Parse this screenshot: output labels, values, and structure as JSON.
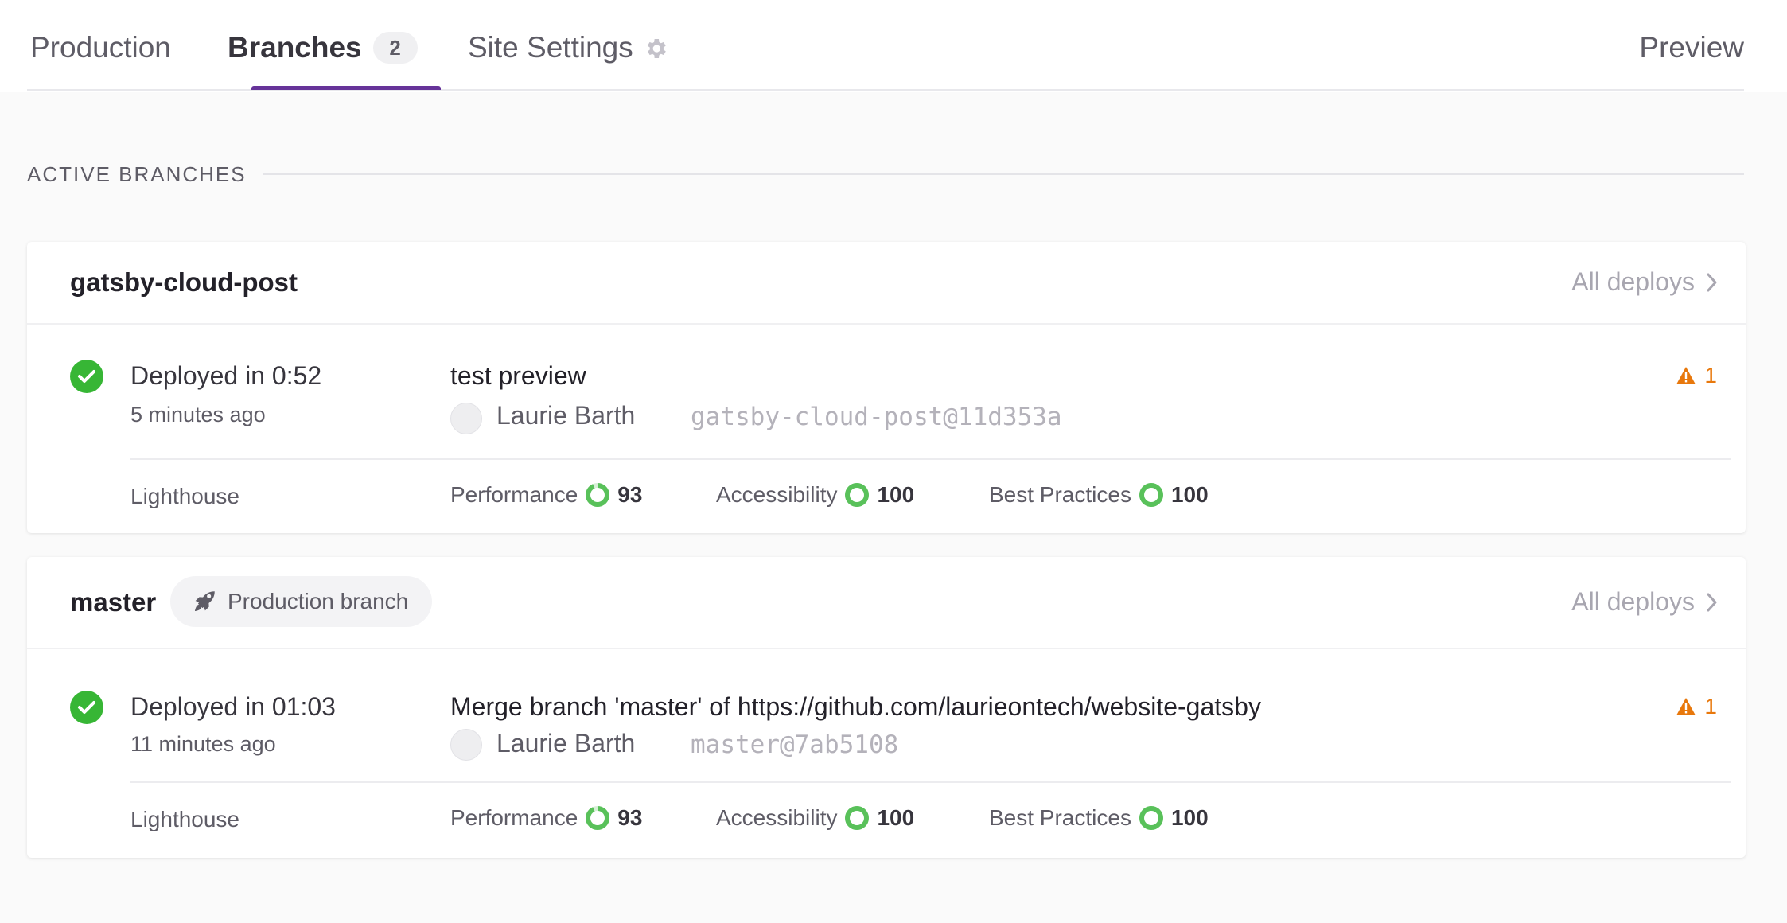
{
  "tabs": [
    {
      "label": "Production"
    },
    {
      "label": "Branches",
      "count": "2"
    },
    {
      "label": "Site Settings"
    }
  ],
  "preview_label": "Preview",
  "section_title": "ACTIVE BRANCHES",
  "colors": {
    "accent": "#663399",
    "success": "#37b635",
    "warning": "#e8780c",
    "ring": "#59c15a"
  },
  "branches": [
    {
      "name": "gatsby-cloud-post",
      "all_deploys": "All deploys",
      "deploy_time": "Deployed in 0:52",
      "deploy_ago": "5 minutes ago",
      "commit_message": "test preview",
      "author": "Laurie Barth",
      "commit_ref": "gatsby-cloud-post@11d353a",
      "warnings": "1",
      "lighthouse_label": "Lighthouse",
      "metrics": [
        {
          "label": "Performance",
          "score": "93",
          "value": 93
        },
        {
          "label": "Accessibility",
          "score": "100",
          "value": 100
        },
        {
          "label": "Best Practices",
          "score": "100",
          "value": 100
        }
      ]
    },
    {
      "name": "master",
      "badge": "Production branch",
      "all_deploys": "All deploys",
      "deploy_time": "Deployed in 01:03",
      "deploy_ago": "11 minutes ago",
      "commit_message": "Merge branch 'master' of https://github.com/laurieontech/website-gatsby",
      "author": "Laurie Barth",
      "commit_ref": "master@7ab5108",
      "warnings": "1",
      "lighthouse_label": "Lighthouse",
      "metrics": [
        {
          "label": "Performance",
          "score": "93",
          "value": 93
        },
        {
          "label": "Accessibility",
          "score": "100",
          "value": 100
        },
        {
          "label": "Best Practices",
          "score": "100",
          "value": 100
        }
      ]
    }
  ]
}
